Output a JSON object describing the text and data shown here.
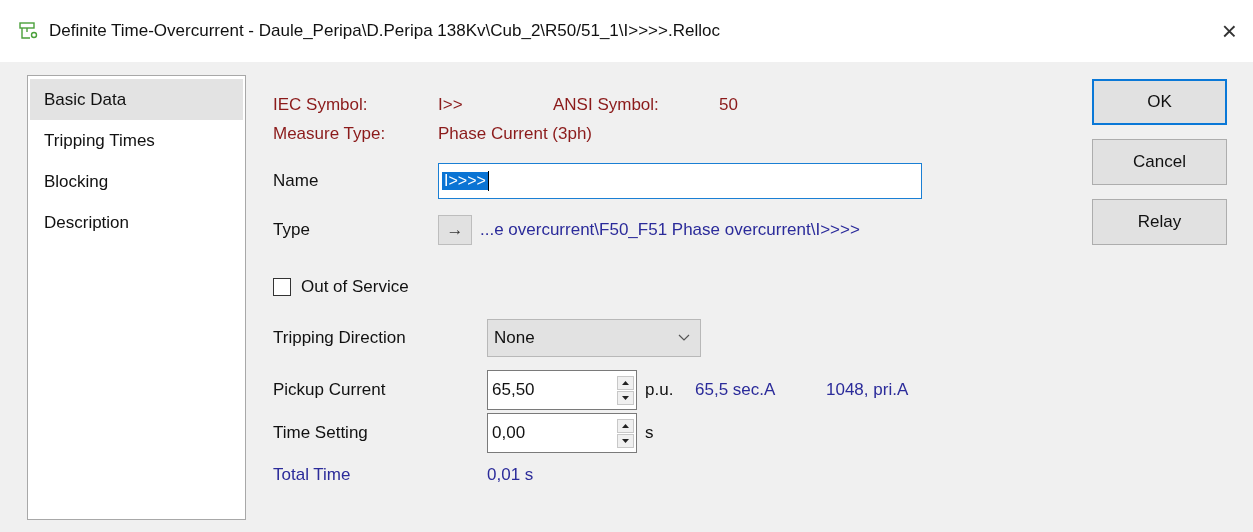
{
  "window": {
    "title": "Definite Time-Overcurrent - Daule_Peripa\\D.Peripa 138Kv\\Cub_2\\R50/51_1\\I>>>>.Relloc",
    "close": "×"
  },
  "sidebar": {
    "items": [
      {
        "label": "Basic Data",
        "selected": true
      },
      {
        "label": "Tripping Times",
        "selected": false
      },
      {
        "label": "Blocking",
        "selected": false
      },
      {
        "label": "Description",
        "selected": false
      }
    ]
  },
  "info": {
    "iec_label": "IEC Symbol:",
    "iec_value": "I>>",
    "ansi_label": "ANSI Symbol:",
    "ansi_value": "50",
    "measure_label": "Measure Type:",
    "measure_value": "Phase Current (3ph)"
  },
  "name": {
    "label": "Name",
    "value": "I>>>>",
    "selected": true
  },
  "type": {
    "label": "Type",
    "button": "→",
    "path": "...e overcurrent\\F50_F51 Phase overcurrent\\I>>>>"
  },
  "out_of_service": {
    "label": "Out of Service",
    "checked": false
  },
  "tripping_direction": {
    "label": "Tripping Direction",
    "value": "None"
  },
  "pickup_current": {
    "label": "Pickup Current",
    "value": "65,50",
    "unit": "p.u.",
    "secondary": "65,5 sec.A",
    "primary": "1048, pri.A"
  },
  "time_setting": {
    "label": "Time Setting",
    "value": "0,00",
    "unit": "s"
  },
  "total_time": {
    "label": "Total Time",
    "value": "0,01 s"
  },
  "buttons": [
    {
      "label": "OK",
      "default": true
    },
    {
      "label": "Cancel",
      "default": false
    },
    {
      "label": "Relay",
      "default": false
    }
  ]
}
